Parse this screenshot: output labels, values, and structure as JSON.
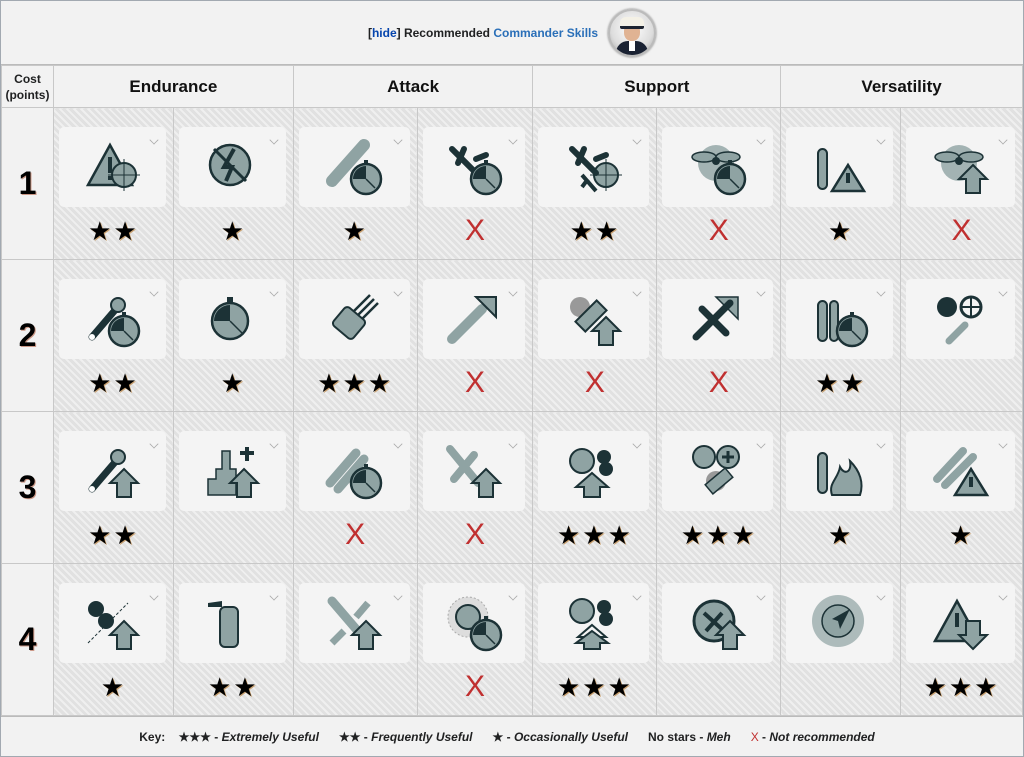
{
  "header": {
    "hide_label": "hide",
    "title_plain": "Recommended",
    "title_link": "Commander Skills",
    "avatar": "commander-portrait"
  },
  "table": {
    "cost_header": [
      "Cost",
      "(points)"
    ],
    "categories": [
      "Endurance",
      "Attack",
      "Support",
      "Versatility"
    ],
    "rows": [
      {
        "cost": "1",
        "cells": [
          {
            "icon": "warning-target",
            "rating": "★★"
          },
          {
            "icon": "no-lightning",
            "rating": "★"
          },
          {
            "icon": "torpedo-timer",
            "rating": "★"
          },
          {
            "icon": "plane-timer",
            "rating": "X"
          },
          {
            "icon": "fighters-target",
            "rating": "★★"
          },
          {
            "icon": "propeller-timer",
            "rating": "X"
          },
          {
            "icon": "ship-warning",
            "rating": "★"
          },
          {
            "icon": "propeller-up",
            "rating": "X"
          }
        ]
      },
      {
        "cost": "2",
        "cells": [
          {
            "icon": "wrench-timer",
            "rating": "★★"
          },
          {
            "icon": "stopwatch",
            "rating": "★"
          },
          {
            "icon": "turret-traverse",
            "rating": "★★★"
          },
          {
            "icon": "torpedo-arrow",
            "rating": "X"
          },
          {
            "icon": "smoke-up",
            "rating": "X"
          },
          {
            "icon": "plane-arrows",
            "rating": "X"
          },
          {
            "icon": "consumables-timer",
            "rating": "★★"
          },
          {
            "icon": "gears-wrench",
            "rating": ""
          }
        ]
      },
      {
        "cost": "3",
        "cells": [
          {
            "icon": "wrench-up",
            "rating": "★★"
          },
          {
            "icon": "superstructure-up",
            "rating": ""
          },
          {
            "icon": "torpedoes-timer",
            "rating": "X"
          },
          {
            "icon": "plane-up",
            "rating": "X"
          },
          {
            "icon": "aa-up",
            "rating": "★★★"
          },
          {
            "icon": "aa-heal-smoke",
            "rating": "★★★"
          },
          {
            "icon": "ship-fire",
            "rating": "★"
          },
          {
            "icon": "torpedoes-warning",
            "rating": "★"
          }
        ]
      },
      {
        "cost": "4",
        "cells": [
          {
            "icon": "secondaries-up",
            "rating": "★"
          },
          {
            "icon": "extinguisher",
            "rating": "★★"
          },
          {
            "icon": "shell-armor-up",
            "rating": ""
          },
          {
            "icon": "radar-timer",
            "rating": "X"
          },
          {
            "icon": "aa-double-up",
            "rating": "★★★"
          },
          {
            "icon": "aa-target-up",
            "rating": ""
          },
          {
            "icon": "detection-compass",
            "rating": ""
          },
          {
            "icon": "warning-down",
            "rating": "★★★"
          }
        ]
      }
    ]
  },
  "key": {
    "label": "Key:",
    "items": [
      {
        "symbol": "★★★",
        "desc": "Extremely Useful"
      },
      {
        "symbol": "★★",
        "desc": "Frequently Useful"
      },
      {
        "symbol": "★",
        "desc": "Occasionally Useful"
      },
      {
        "symbol": "No stars",
        "desc": "Meh"
      },
      {
        "symbol": "X",
        "desc": "Not recommended"
      }
    ]
  },
  "colors": {
    "not_recommended": "#c03030",
    "link": "#2a6fb8",
    "icon_fill": "#8fa3a3",
    "icon_dark": "#1c3236"
  }
}
